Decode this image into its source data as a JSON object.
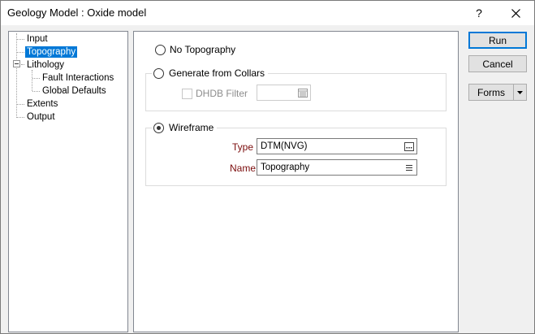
{
  "window": {
    "title": "Geology Model : Oxide model",
    "help_label": "?"
  },
  "tree": {
    "items": [
      {
        "label": "Input",
        "selected": false
      },
      {
        "label": "Topography",
        "selected": true
      },
      {
        "label": "Lithology",
        "selected": false
      },
      {
        "label": "Fault Interactions",
        "selected": false
      },
      {
        "label": "Global Defaults",
        "selected": false
      },
      {
        "label": "Extents",
        "selected": false
      },
      {
        "label": "Output",
        "selected": false
      }
    ]
  },
  "topography": {
    "no_topography_label": "No Topography",
    "no_topography_checked": false,
    "generate_label": "Generate from Collars",
    "generate_checked": false,
    "dhdb_filter_label": "DHDB Filter",
    "dhdb_filter_checked": false,
    "dhdb_filter_value": "",
    "wireframe_label": "Wireframe",
    "wireframe_checked": true,
    "type_label": "Type",
    "type_value": "DTM(NVG)",
    "name_label": "Name",
    "name_value": "Topography"
  },
  "actions": {
    "run_label": "Run",
    "cancel_label": "Cancel",
    "forms_label": "Forms"
  },
  "colors": {
    "selection": "#0078d7",
    "required_label": "#7b0c0c"
  }
}
